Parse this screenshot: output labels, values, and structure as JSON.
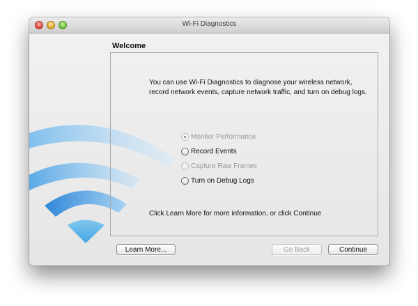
{
  "window": {
    "title": "Wi-Fi Diagnostics"
  },
  "section": {
    "title": "Welcome"
  },
  "intro": "You can use Wi-Fi Diagnostics to diagnose your wireless network, record network events, capture network traffic, and turn on debug logs.",
  "options": [
    {
      "label": "Monitor Performance",
      "selected": true,
      "enabled": false
    },
    {
      "label": "Record Events",
      "selected": false,
      "enabled": true
    },
    {
      "label": "Capture Raw Frames",
      "selected": false,
      "enabled": false
    },
    {
      "label": "Turn on Debug Logs",
      "selected": false,
      "enabled": true
    }
  ],
  "footer_text": "Click Learn More for more information, or click Continue",
  "buttons": {
    "learn_more": "Learn More...",
    "go_back": "Go Back",
    "continue": "Continue"
  },
  "colors": {
    "wifi_light": "#b9dcf5",
    "wifi_mid": "#5aaee6",
    "wifi_dark": "#2f87d8"
  }
}
